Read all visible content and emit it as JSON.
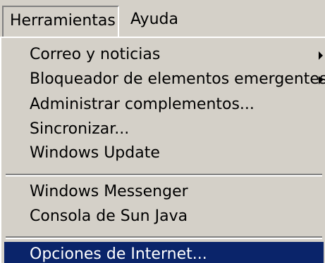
{
  "menubar": {
    "tools_label": "Herramientas",
    "help_label": "Ayuda"
  },
  "menu": {
    "items": [
      {
        "label": "Correo y noticias",
        "submenu": true
      },
      {
        "label": "Bloqueador de elementos emergentes",
        "submenu": true
      },
      {
        "label": "Administrar complementos...",
        "submenu": false
      },
      {
        "label": "Sincronizar...",
        "submenu": false
      },
      {
        "label": "Windows Update",
        "submenu": false
      },
      {
        "label": "Windows Messenger",
        "submenu": false
      },
      {
        "label": "Consola de Sun Java",
        "submenu": false
      },
      {
        "label": "Opciones de Internet...",
        "submenu": false,
        "highlighted": true
      }
    ]
  },
  "colors": {
    "menu_background": "#d4d0c8",
    "highlight_background": "#0a246a",
    "highlight_text": "#ffffff"
  },
  "icons": {
    "submenu_arrow": "triangle-right-icon"
  }
}
